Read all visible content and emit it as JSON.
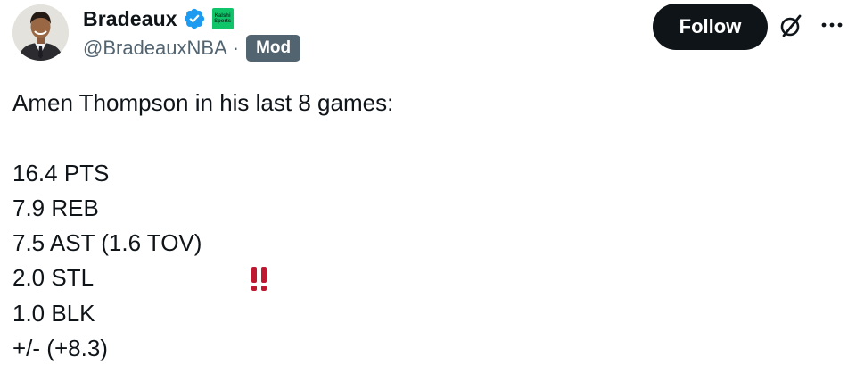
{
  "author": {
    "display_name": "Bradeaux",
    "handle": "@BradeauxNBA",
    "separator": "·",
    "role_badge": "Mod",
    "verified": true,
    "affiliate_badge_text": [
      "Kalshi",
      "Sports"
    ],
    "affiliate_color": "#10c46a"
  },
  "actions": {
    "follow_label": "Follow",
    "grok_icon": "grok-icon",
    "more_icon": "more-icon"
  },
  "tweet": {
    "lines": [
      "Amen Thompson in his last 8 games:",
      "",
      "16.4 PTS",
      "7.9 REB",
      "7.5 AST (1.6 TOV)",
      "2.0 STL",
      "1.0 BLK",
      "+/- (+8.3)"
    ],
    "emoji_after_line_index": 4,
    "emoji": "double-exclamation-icon"
  },
  "colors": {
    "text": "#0f1419",
    "secondary": "#536471",
    "verified": "#1d9bf0",
    "emoji": "#be1931"
  }
}
